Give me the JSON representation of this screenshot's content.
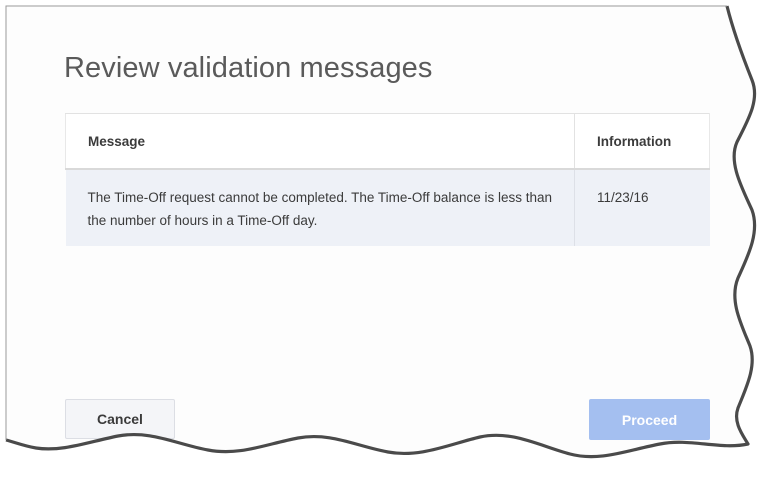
{
  "dialog": {
    "title": "Review validation messages",
    "close_label": "×"
  },
  "table": {
    "headers": [
      "Message",
      "Information"
    ],
    "rows": [
      {
        "message": "The Time-Off request cannot be completed. The Time-Off balance is less than the number of hours in a Time-Off day.",
        "information": "11/23/16"
      }
    ]
  },
  "buttons": {
    "cancel_label": "Cancel",
    "proceed_label": "Proceed",
    "proceed_enabled": false
  },
  "colors": {
    "proceed_bg": "#a4bff0",
    "row_bg": "#eef1f7",
    "title_text": "#5a5a5a"
  }
}
